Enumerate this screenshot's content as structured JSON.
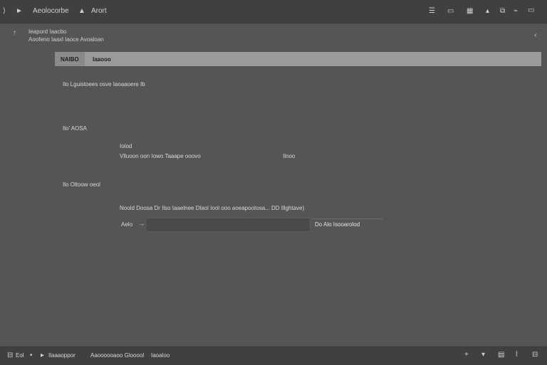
{
  "topbar": {
    "title": "Aeolocorbe",
    "subtitle": "Arort",
    "icons": [
      "chevron-right-icon",
      "play-icon",
      "list-icon",
      "panel-icon",
      "grid-icon",
      "up-icon",
      "export-icon",
      "tool-icon",
      "window-icon"
    ]
  },
  "breadcrumb": {
    "line1": "Ieapord Iaacbo",
    "line2": "Aoofeno Iaaxl Iaoce Avoaloan"
  },
  "strip": {
    "tab_label": "NAIBO",
    "label": "Iaaooo"
  },
  "content": {
    "description": "Ilo Lguistoees osve Iaoaaoere Ib",
    "section1_title": "Ilo' AOSA",
    "field_label": "Iolod",
    "field_value": "Vlluoon oon Iowo Taaape ooovo",
    "field_value_right": "Ilnoo",
    "section2_title": "Ilo Oltoow oeol",
    "instruction": "Noold Doosa Dr Ilso Iaaelnee Dlaol Iool ooo aoeapootosa... DD Illghtave)",
    "input_label": "Aelo",
    "input_value": "",
    "button_label": "Do Alo Isooarolod"
  },
  "bottombar": {
    "status_left": "Eol",
    "status_text1": "Ilaaaoppor",
    "status_text2": "Aaoooooaoo Glooool",
    "status_text3": "Iaoaloo"
  }
}
